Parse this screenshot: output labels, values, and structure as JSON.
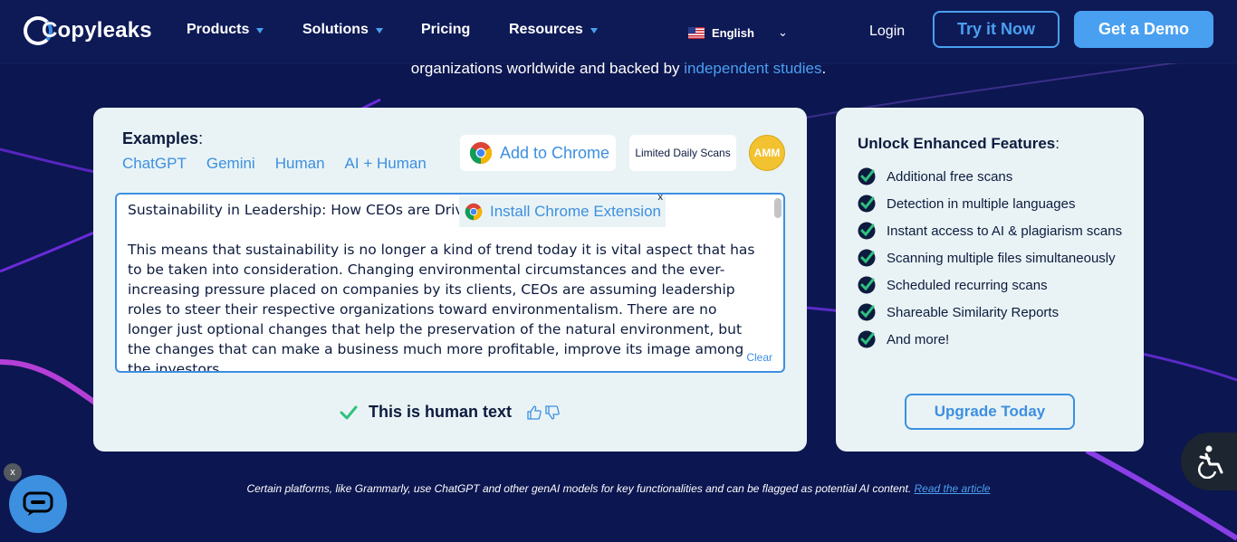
{
  "nav": {
    "logo_text": "Copyleaks",
    "items": [
      "Products",
      "Solutions",
      "Pricing",
      "Resources"
    ],
    "language": "English",
    "login": "Login",
    "try_now": "Try it Now",
    "demo": "Get a Demo"
  },
  "hero": {
    "subtitle": "organizations worldwide and backed by",
    "subtitle_link": "independent studies",
    "subtitle_end": "."
  },
  "checker": {
    "examples_label": "Examples",
    "examples_colon": ":",
    "examples": [
      "ChatGPT",
      "Gemini",
      "Human",
      "AI + Human"
    ],
    "add_to_chrome": "Add to Chrome",
    "limited": "Limited Daily Scans",
    "avatar": "AMM",
    "install_ext": "Install Chrome Extension",
    "install_close": "x",
    "text_title": "Sustainability in Leadership: How CEOs are Driv",
    "text_body": "This means that sustainability is no longer a kind of trend today it is vital aspect that has to be taken into consideration. Changing environmental circumstances and the ever-increasing pressure placed on companies by its clients, CEOs are assuming leadership roles to steer their respective organizations toward environmentalism. There are no longer just optional changes that help the preservation of the natural environment, but the changes that can make a business much more profitable, improve its image among the investors.",
    "clear": "Clear",
    "result": "This is human text"
  },
  "side": {
    "title": "Unlock Enhanced Features",
    "title_colon": ":",
    "features": [
      "Additional free scans",
      "Detection in multiple languages",
      "Instant access to AI & plagiarism scans",
      "Scanning multiple files simultaneously",
      "Scheduled recurring scans",
      "Shareable Similarity Reports",
      "And more!"
    ],
    "upgrade": "Upgrade Today"
  },
  "footer": {
    "disclaimer": "Certain platforms, like Grammarly, use ChatGPT and other genAI models for key functionalities and can be flagged as potential AI content.",
    "link": "Read the article",
    "chat_close": "x"
  },
  "colors": {
    "background": "#0c1650",
    "accent": "#3d8fe0",
    "card": "#e9f3f5",
    "success": "#2ec27e",
    "avatar": "#f2c230"
  }
}
